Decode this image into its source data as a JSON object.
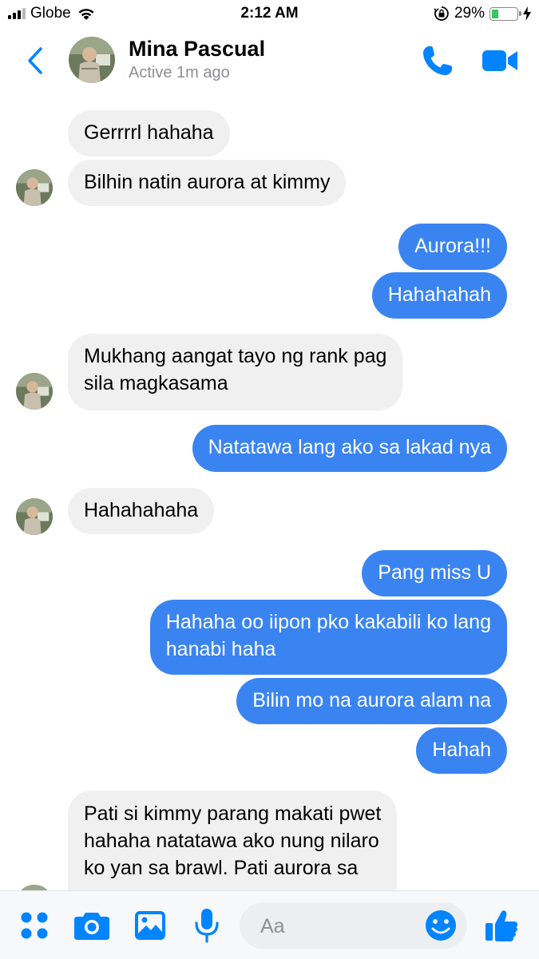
{
  "status_bar": {
    "carrier": "Globe",
    "time": "2:12 AM",
    "battery_percent": "29%",
    "battery_level": 0.29,
    "icons": [
      "signal-icon",
      "wifi-icon",
      "orientation-lock-icon",
      "battery-icon",
      "charging-bolt-icon"
    ]
  },
  "header": {
    "contact_name": "Mina Pascual",
    "contact_status": "Active 1m ago",
    "icons": [
      "back-chevron-icon",
      "phone-icon",
      "video-camera-icon"
    ]
  },
  "messages": [
    {
      "side": "in",
      "text": "Gerrrrl hahaha"
    },
    {
      "side": "in",
      "text": "Bilhin natin aurora at kimmy"
    },
    {
      "side": "out",
      "text": "Aurora!!!"
    },
    {
      "side": "out",
      "text": "Hahahahah"
    },
    {
      "side": "in",
      "line1": "Mukhang aangat tayo ng rank pag",
      "line2": "sila magkasama"
    },
    {
      "side": "out",
      "text": "Natatawa lang ako sa lakad nya"
    },
    {
      "side": "in",
      "text": "Hahahahaha"
    },
    {
      "side": "out",
      "text": "Pang miss U"
    },
    {
      "side": "out",
      "line1": "Hahaha oo iipon pko kakabili ko lang",
      "line2": "hanabi haha"
    },
    {
      "side": "out",
      "text": "Bilin mo na aurora alam na"
    },
    {
      "side": "out",
      "text": "Hahah"
    },
    {
      "side": "in",
      "line1": "Pati si kimmy parang makati pwet",
      "line2": "hahaha natatawa ako nung nilaro",
      "line3": "ko yan sa brawl. Pati aurora sa"
    }
  ],
  "composer": {
    "placeholder": "Aa",
    "icons": [
      "apps-grid-icon",
      "camera-icon",
      "image-icon",
      "microphone-icon",
      "emoji-icon",
      "thumbs-up-icon"
    ]
  },
  "colors": {
    "accent": "#0084ff",
    "outgoing_bubble": "#3a84f2",
    "incoming_bubble": "#f0f0f0",
    "battery_green": "#34c759"
  }
}
